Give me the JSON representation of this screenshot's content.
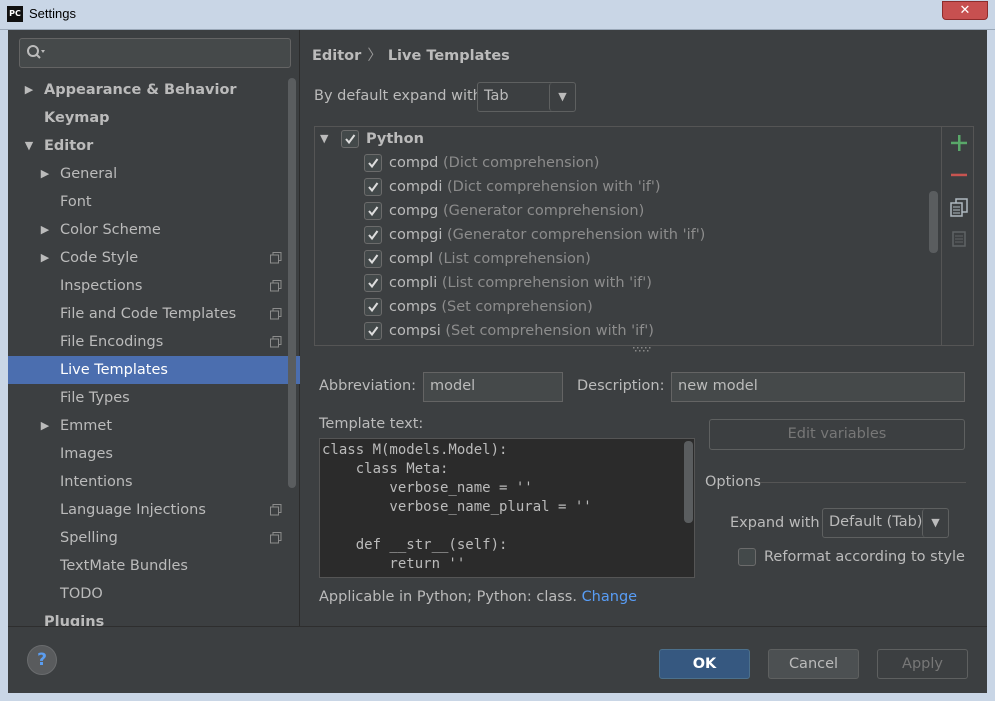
{
  "window": {
    "title": "Settings",
    "app_icon": "PC",
    "close_glyph": "✕"
  },
  "search": {
    "placeholder": ""
  },
  "sidebar": {
    "items": [
      {
        "label": "Appearance & Behavior"
      },
      {
        "label": "Keymap"
      },
      {
        "label": "Editor"
      },
      {
        "label": "General"
      },
      {
        "label": "Font"
      },
      {
        "label": "Color Scheme"
      },
      {
        "label": "Code Style"
      },
      {
        "label": "Inspections"
      },
      {
        "label": "File and Code Templates"
      },
      {
        "label": "File Encodings"
      },
      {
        "label": "Live Templates"
      },
      {
        "label": "File Types"
      },
      {
        "label": "Emmet"
      },
      {
        "label": "Images"
      },
      {
        "label": "Intentions"
      },
      {
        "label": "Language Injections"
      },
      {
        "label": "Spelling"
      },
      {
        "label": "TextMate Bundles"
      },
      {
        "label": "TODO"
      },
      {
        "label": "Plugins"
      }
    ]
  },
  "breadcrumb": {
    "parent": "Editor",
    "separator": "〉",
    "current": "Live Templates"
  },
  "expand_default": {
    "label": "By default expand with",
    "value": "Tab"
  },
  "templates": {
    "group": "Python",
    "items": [
      {
        "name": "compd",
        "desc": "(Dict comprehension)"
      },
      {
        "name": "compdi",
        "desc": "(Dict comprehension with 'if')"
      },
      {
        "name": "compg",
        "desc": "(Generator comprehension)"
      },
      {
        "name": "compgi",
        "desc": "(Generator comprehension with 'if')"
      },
      {
        "name": "compl",
        "desc": "(List comprehension)"
      },
      {
        "name": "compli",
        "desc": "(List comprehension with 'if')"
      },
      {
        "name": "comps",
        "desc": "(Set comprehension)"
      },
      {
        "name": "compsi",
        "desc": "(Set comprehension with 'if')"
      }
    ]
  },
  "editor": {
    "abbreviation_label": "Abbreviation:",
    "abbreviation_value": "model",
    "description_label": "Description:",
    "description_value": "new model",
    "template_text_label": "Template text:",
    "template_text": "class M(models.Model):\n    class Meta:\n        verbose_name = ''\n        verbose_name_plural = ''\n\n    def __str__(self):\n        return ''",
    "edit_variables": "Edit variables",
    "options_label": "Options",
    "expand_with_label": "Expand with",
    "expand_with_value": "Default (Tab)",
    "reformat_label": "Reformat according to style",
    "applicable_text": "Applicable in Python; Python: class.",
    "change_link": "Change"
  },
  "buttons": {
    "help": "?",
    "ok": "OK",
    "cancel": "Cancel",
    "apply": "Apply"
  },
  "colors": {
    "background": "#3c3f41",
    "selection": "#4b6eaf",
    "link": "#589df6",
    "ok_button": "#365880",
    "add": "#59a869",
    "remove": "#c75450"
  }
}
